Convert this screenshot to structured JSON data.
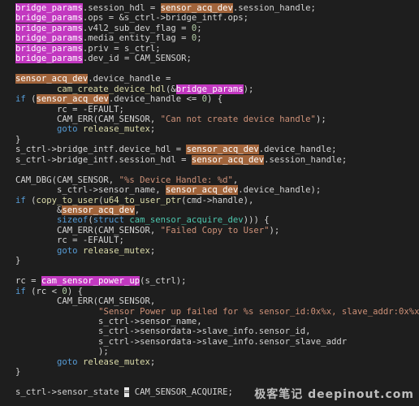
{
  "editor": {
    "lines": [
      [
        {
          "t": "bridge_params",
          "c": "hl-pink"
        },
        {
          "t": ".session_hdl = ",
          "c": "plain"
        },
        {
          "t": "sensor_acq_dev",
          "c": "hl-brown"
        },
        {
          "t": ".session_handle;",
          "c": "plain"
        }
      ],
      [
        {
          "t": "bridge_params",
          "c": "hl-pink"
        },
        {
          "t": ".ops = &s_ctrl->bridge_intf.ops;",
          "c": "plain"
        }
      ],
      [
        {
          "t": "bridge_params",
          "c": "hl-pink"
        },
        {
          "t": ".v4l2_sub_dev_flag = ",
          "c": "plain"
        },
        {
          "t": "0",
          "c": "num"
        },
        {
          "t": ";",
          "c": "plain"
        }
      ],
      [
        {
          "t": "bridge_params",
          "c": "hl-pink"
        },
        {
          "t": ".media_entity_flag = ",
          "c": "plain"
        },
        {
          "t": "0",
          "c": "num"
        },
        {
          "t": ";",
          "c": "plain"
        }
      ],
      [
        {
          "t": "bridge_params",
          "c": "hl-pink"
        },
        {
          "t": ".priv = s_ctrl;",
          "c": "plain"
        }
      ],
      [
        {
          "t": "bridge_params",
          "c": "hl-pink"
        },
        {
          "t": ".dev_id = CAM_SENSOR;",
          "c": "plain"
        }
      ],
      [],
      [
        {
          "t": "sensor_acq_dev",
          "c": "hl-brown"
        },
        {
          "t": ".device_handle =",
          "c": "plain"
        }
      ],
      [
        {
          "t": "        ",
          "c": "plain"
        },
        {
          "t": "cam_create_device_hdl",
          "c": "fn"
        },
        {
          "t": "(&",
          "c": "plain"
        },
        {
          "t": "bridge_params",
          "c": "hl-pink"
        },
        {
          "t": ");",
          "c": "plain"
        }
      ],
      [
        {
          "t": "if",
          "c": "kw"
        },
        {
          "t": " (",
          "c": "plain"
        },
        {
          "t": "sensor_acq_dev",
          "c": "hl-brown"
        },
        {
          "t": ".device_handle <= ",
          "c": "plain"
        },
        {
          "t": "0",
          "c": "num"
        },
        {
          "t": ") {",
          "c": "plain"
        }
      ],
      [
        {
          "t": "        rc = -EFAULT;",
          "c": "plain"
        }
      ],
      [
        {
          "t": "        CAM_ERR(CAM_SENSOR, ",
          "c": "plain"
        },
        {
          "t": "\"Can not create device handle\"",
          "c": "str"
        },
        {
          "t": ");",
          "c": "plain"
        }
      ],
      [
        {
          "t": "        ",
          "c": "plain"
        },
        {
          "t": "goto",
          "c": "kw"
        },
        {
          "t": " ",
          "c": "plain"
        },
        {
          "t": "release_mutex",
          "c": "fn"
        },
        {
          "t": ";",
          "c": "plain"
        }
      ],
      [
        {
          "t": "}",
          "c": "plain"
        }
      ],
      [
        {
          "t": "s_ctrl->bridge_intf.device_hdl = ",
          "c": "plain"
        },
        {
          "t": "sensor_acq_dev",
          "c": "hl-brown"
        },
        {
          "t": ".device_handle;",
          "c": "plain"
        }
      ],
      [
        {
          "t": "s_ctrl->bridge_intf.session_hdl = ",
          "c": "plain"
        },
        {
          "t": "sensor_acq_dev",
          "c": "hl-brown"
        },
        {
          "t": ".session_handle;",
          "c": "plain"
        }
      ],
      [],
      [
        {
          "t": "CAM_DBG(CAM_SENSOR, ",
          "c": "plain"
        },
        {
          "t": "\"%s Device Handle: %d\"",
          "c": "str"
        },
        {
          "t": ",",
          "c": "plain"
        }
      ],
      [
        {
          "t": "        s_ctrl->sensor_name, ",
          "c": "plain"
        },
        {
          "t": "sensor_acq_dev",
          "c": "hl-brown"
        },
        {
          "t": ".device_handle);",
          "c": "plain"
        }
      ],
      [
        {
          "t": "if",
          "c": "kw"
        },
        {
          "t": " (",
          "c": "plain"
        },
        {
          "t": "copy_to_user",
          "c": "fn"
        },
        {
          "t": "(",
          "c": "plain"
        },
        {
          "t": "u64_to_user_ptr",
          "c": "fn"
        },
        {
          "t": "(cmd->handle),",
          "c": "plain"
        }
      ],
      [
        {
          "t": "        &",
          "c": "plain"
        },
        {
          "t": "sensor_acq_dev",
          "c": "hl-brown"
        },
        {
          "t": ",",
          "c": "plain"
        }
      ],
      [
        {
          "t": "        ",
          "c": "plain"
        },
        {
          "t": "sizeof",
          "c": "kw"
        },
        {
          "t": "(",
          "c": "plain"
        },
        {
          "t": "struct",
          "c": "kw"
        },
        {
          "t": " ",
          "c": "plain"
        },
        {
          "t": "cam_sensor_acquire_dev",
          "c": "mac"
        },
        {
          "t": "))) {",
          "c": "plain"
        }
      ],
      [
        {
          "t": "        CAM_ERR(CAM_SENSOR, ",
          "c": "plain"
        },
        {
          "t": "\"Failed Copy to User\"",
          "c": "str"
        },
        {
          "t": ");",
          "c": "plain"
        }
      ],
      [
        {
          "t": "        rc = -EFAULT;",
          "c": "plain"
        }
      ],
      [
        {
          "t": "        ",
          "c": "plain"
        },
        {
          "t": "goto",
          "c": "kw"
        },
        {
          "t": " ",
          "c": "plain"
        },
        {
          "t": "release_mutex",
          "c": "fn"
        },
        {
          "t": ";",
          "c": "plain"
        }
      ],
      [
        {
          "t": "}",
          "c": "plain"
        }
      ],
      [],
      [
        {
          "t": "rc = ",
          "c": "plain"
        },
        {
          "t": "cam_sensor_power_up",
          "c": "hl-pink"
        },
        {
          "t": "(s_ctrl);",
          "c": "plain"
        }
      ],
      [
        {
          "t": "if",
          "c": "kw"
        },
        {
          "t": " (rc < ",
          "c": "plain"
        },
        {
          "t": "0",
          "c": "num"
        },
        {
          "t": ") {",
          "c": "plain"
        }
      ],
      [
        {
          "t": "        CAM_ERR(CAM_SENSOR,",
          "c": "plain"
        }
      ],
      [
        {
          "t": "                ",
          "c": "plain"
        },
        {
          "t": "\"Sensor Power up failed for %s sensor_id:0x%x, slave_addr:0x%x\"",
          "c": "str"
        },
        {
          "t": ",",
          "c": "plain"
        }
      ],
      [
        {
          "t": "                s_ctrl->sensor_name,",
          "c": "plain"
        }
      ],
      [
        {
          "t": "                s_ctrl->sensordata->slave_info.sensor_id,",
          "c": "plain"
        }
      ],
      [
        {
          "t": "                s_ctrl->sensordata->slave_info.sensor_slave_addr",
          "c": "plain"
        }
      ],
      [
        {
          "t": "                );",
          "c": "plain"
        }
      ],
      [
        {
          "t": "        ",
          "c": "plain"
        },
        {
          "t": "goto",
          "c": "kw"
        },
        {
          "t": " ",
          "c": "plain"
        },
        {
          "t": "release_mutex",
          "c": "fn"
        },
        {
          "t": ";",
          "c": "plain"
        }
      ],
      [
        {
          "t": "}",
          "c": "plain"
        }
      ],
      [],
      [
        {
          "t": "s_ctrl->sensor_state ",
          "c": "plain"
        },
        {
          "t": "=",
          "c": "cursor"
        },
        {
          "t": " CAM_SENSOR_ACQUIRE;",
          "c": "plain"
        }
      ]
    ]
  },
  "watermark": {
    "text": "极客笔记 deepinout.com"
  },
  "colors": {
    "background": "#1e1e1e",
    "pink_highlight": "#c238c0",
    "brown_highlight": "#a1643b"
  }
}
